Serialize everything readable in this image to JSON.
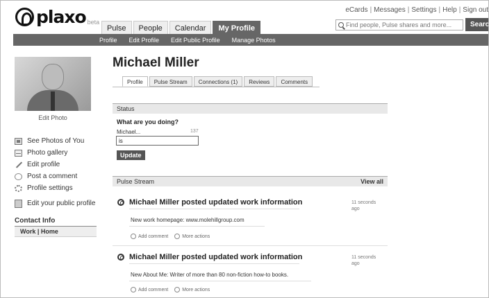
{
  "logo": {
    "text": "plaxo",
    "beta": "beta"
  },
  "top_links": [
    "eCards",
    "Messages",
    "Settings",
    "Help",
    "Sign out"
  ],
  "search": {
    "placeholder": "Find people, Pulse shares and more...",
    "button": "Search"
  },
  "main_tabs": [
    {
      "label": "Pulse",
      "active": false
    },
    {
      "label": "People",
      "active": false
    },
    {
      "label": "Calendar",
      "active": false
    },
    {
      "label": "My Profile",
      "active": true
    }
  ],
  "sub_nav": [
    "Profile",
    "Edit Profile",
    "Edit Public Profile",
    "Manage Photos"
  ],
  "sidebar": {
    "edit_photo": "Edit Photo",
    "links": [
      {
        "label": "See Photos of You",
        "icon": "photos-icon"
      },
      {
        "label": "Photo gallery",
        "icon": "gallery-icon"
      },
      {
        "label": "Edit profile",
        "icon": "pencil-icon"
      },
      {
        "label": "Post a comment",
        "icon": "comment-icon"
      },
      {
        "label": "Profile settings",
        "icon": "settings-icon"
      },
      {
        "label": "Edit your public profile",
        "icon": "public-profile-icon"
      }
    ],
    "contact_info": {
      "title": "Contact Info",
      "tabs": "Work | Home"
    }
  },
  "profile": {
    "name": "Michael Miller",
    "tabs": [
      {
        "label": "Profile",
        "active": true
      },
      {
        "label": "Pulse Stream",
        "active": false
      },
      {
        "label": "Connections (1)",
        "active": false
      },
      {
        "label": "Reviews",
        "active": false
      },
      {
        "label": "Comments",
        "active": false
      }
    ]
  },
  "status": {
    "header": "Status",
    "question": "What are you doing?",
    "name_prefix": "Michael...",
    "char_count": "137",
    "input_value": "is",
    "update_button": "Update"
  },
  "pulse_stream": {
    "header": "Pulse Stream",
    "view_all": "View all",
    "posts": [
      {
        "title": "Michael Miller posted updated work information",
        "time": "11 seconds ago",
        "detail": "New work homepage:  www.molehillgroup.com",
        "add_comment": "Add comment",
        "more_actions": "More actions"
      },
      {
        "title": "Michael Miller posted updated work information",
        "time": "11 seconds ago",
        "detail": "New About Me:  Writer of more than 80 non-fiction how-to books.",
        "add_comment": "Add comment",
        "more_actions": "More actions"
      }
    ]
  }
}
